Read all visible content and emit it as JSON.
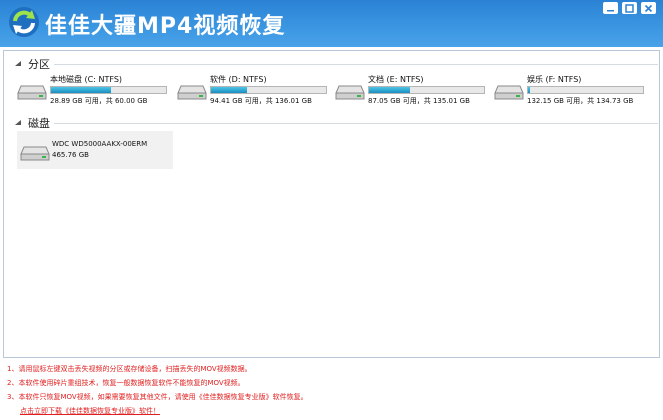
{
  "app": {
    "title": "佳佳大疆MP4视频恢复",
    "logo_icon": "refresh-arrows-icon",
    "accent": "#2f8ad9"
  },
  "partitions": {
    "header": "分区",
    "items": [
      {
        "name": "本地磁盘 (C: NTFS)",
        "info": "28.89 GB 可用，共 60.00 GB",
        "used_fraction": 0.52
      },
      {
        "name": "软件 (D: NTFS)",
        "info": "94.41 GB 可用，共 136.01 GB",
        "used_fraction": 0.31
      },
      {
        "name": "文档 (E: NTFS)",
        "info": "87.05 GB 可用，共 135.01 GB",
        "used_fraction": 0.36
      },
      {
        "name": "娱乐 (F: NTFS)",
        "info": "132.15 GB 可用，共 134.73 GB",
        "used_fraction": 0.02
      }
    ]
  },
  "disks": {
    "header": "磁盘",
    "items": [
      {
        "name": "WDC WD5000AAKX-00ERM",
        "size": "465.76 GB"
      }
    ]
  },
  "notes": [
    "1、请用鼠标左键双击丢失视频的分区或存储设备，扫描丢失的MOV视频数据。",
    "2、本软件使用碎片重组技术，恢复一般数据恢复软件不能恢复的MOV视频。",
    "3、本软件只恢复MOV视频，如果需要恢复其他文件，请使用《佳佳数据恢复专业版》软件恢复。"
  ],
  "download_link": "点击立即下载《佳佳数据恢复专业版》软件！"
}
